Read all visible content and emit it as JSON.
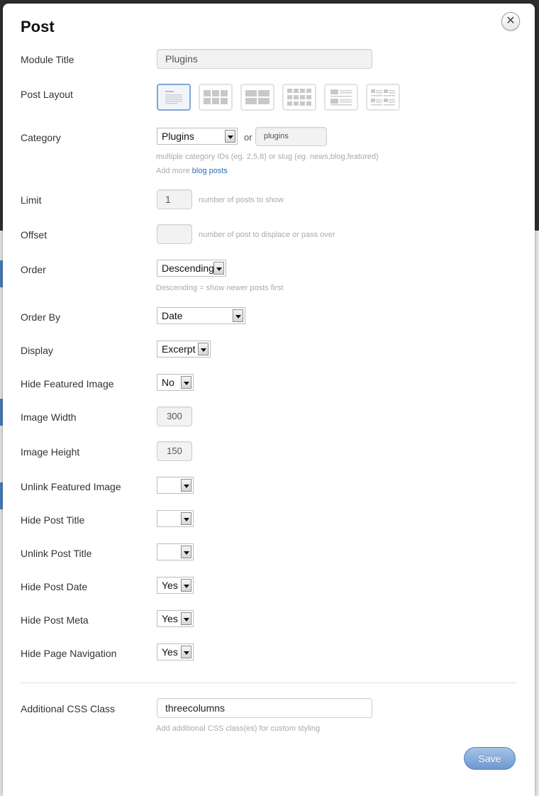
{
  "dialog": {
    "title": "Post",
    "close_glyph": "✕"
  },
  "fields": {
    "module_title": {
      "label": "Module Title",
      "value": "Plugins"
    },
    "post_layout": {
      "label": "Post Layout",
      "options": [
        "list-post",
        "grid4",
        "grid3",
        "grid2",
        "list-thumb-image",
        "grid2-thumb"
      ],
      "selected": "list-post"
    },
    "category": {
      "label": "Category",
      "value": "Plugins",
      "or_text": "or",
      "slug_value": "plugins",
      "hint": "multiple category IDs (eg. 2,5,8) or slug (eg. news,blog,featured)",
      "add_more_prefix": "Add more",
      "add_more_link": "blog posts"
    },
    "limit": {
      "label": "Limit",
      "value": "1",
      "hint": "number of posts to show"
    },
    "offset": {
      "label": "Offset",
      "value": "",
      "hint": "number of post to displace or pass over"
    },
    "order": {
      "label": "Order",
      "value": "Descending",
      "hint": "Descending = show newer posts first"
    },
    "order_by": {
      "label": "Order By",
      "value": "Date"
    },
    "display": {
      "label": "Display",
      "value": "Excerpt"
    },
    "hide_featured_image": {
      "label": "Hide Featured Image",
      "value": "No"
    },
    "image_width": {
      "label": "Image Width",
      "value": "300"
    },
    "image_height": {
      "label": "Image Height",
      "value": "150"
    },
    "unlink_featured_image": {
      "label": "Unlink Featured Image",
      "value": ""
    },
    "hide_post_title": {
      "label": "Hide Post Title",
      "value": ""
    },
    "unlink_post_title": {
      "label": "Unlink Post Title",
      "value": ""
    },
    "hide_post_date": {
      "label": "Hide Post Date",
      "value": "Yes"
    },
    "hide_post_meta": {
      "label": "Hide Post Meta",
      "value": "Yes"
    },
    "hide_page_navigation": {
      "label": "Hide Page Navigation",
      "value": "Yes"
    },
    "additional_css_class": {
      "label": "Additional CSS Class",
      "value": "threecolumns",
      "hint": "Add additional CSS class(es) for custom styling"
    }
  },
  "actions": {
    "save_label": "Save"
  },
  "colors": {
    "accent": "#7fa6d6",
    "save_button": "#6e98d0",
    "link": "#2a6fb0"
  }
}
